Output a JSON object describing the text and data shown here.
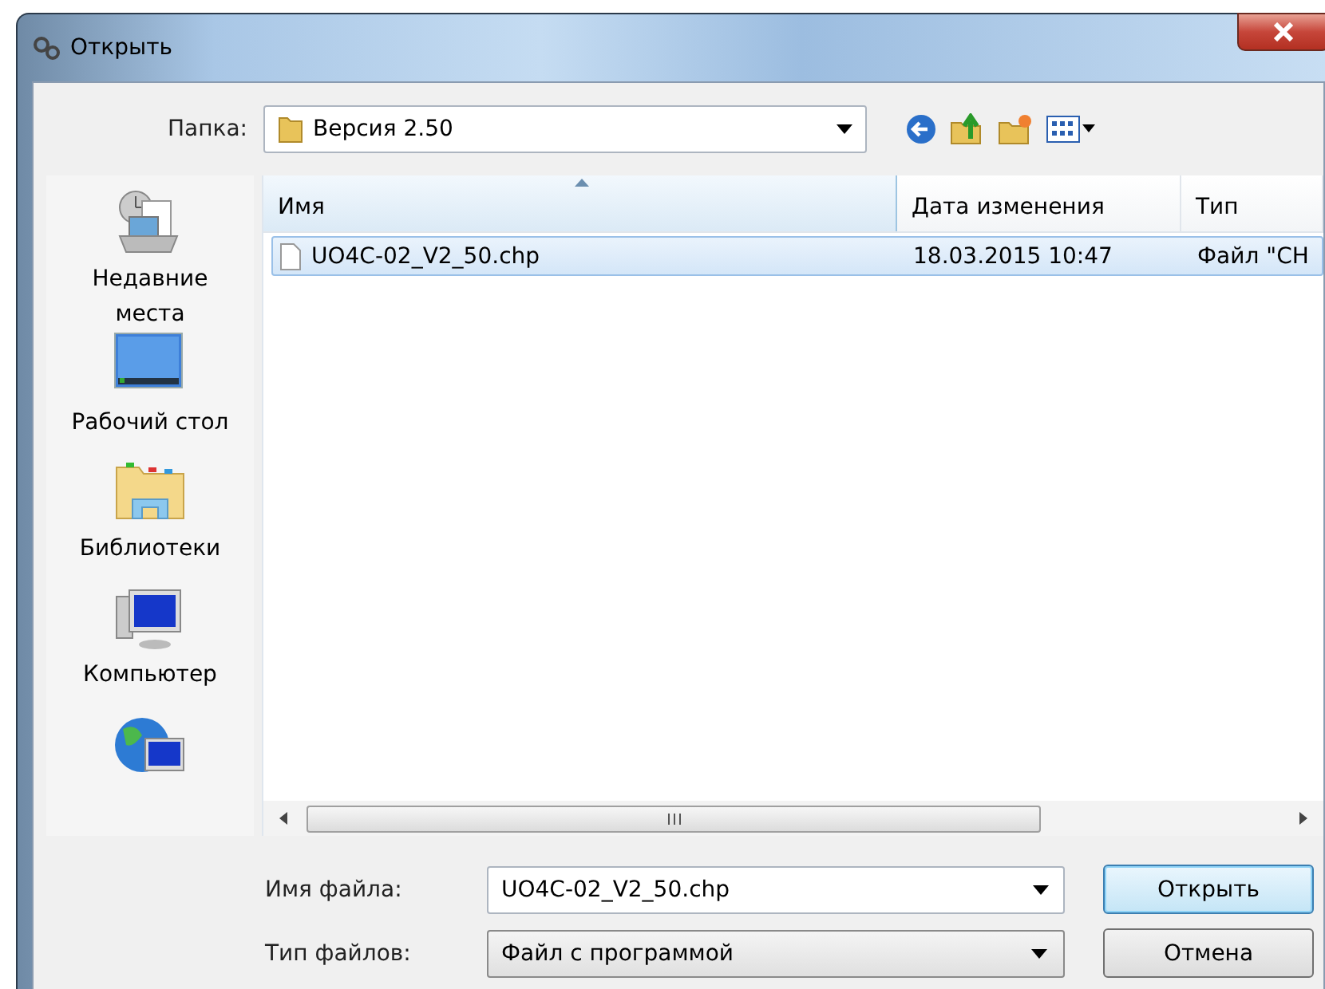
{
  "window": {
    "title": "Открыть"
  },
  "folder": {
    "label": "Папка:",
    "value": "Версия 2.50"
  },
  "sidebar": {
    "items": [
      {
        "kind": "recent",
        "label": "Недавние места"
      },
      {
        "kind": "desktop",
        "label": "Рабочий стол"
      },
      {
        "kind": "libraries",
        "label": "Библиотеки"
      },
      {
        "kind": "computer",
        "label": "Компьютер"
      },
      {
        "kind": "network"
      }
    ]
  },
  "table": {
    "columns": [
      {
        "label": "Имя",
        "sorted": true
      },
      {
        "label": "Дата изменения",
        "sorted": false
      },
      {
        "label": "Тип",
        "sorted": false
      }
    ],
    "rows": [
      {
        "cells": [
          "UO4C-02_V2_50.chp",
          "18.03.2015 10:47",
          "Файл \"CH"
        ],
        "selected": true
      }
    ]
  },
  "file_name": {
    "label": "Имя файла:",
    "value": "UO4C-02_V2_50.chp"
  },
  "file_type": {
    "label": "Тип файлов:",
    "value": "Файл с программой"
  },
  "buttons": [
    {
      "label": "Открыть",
      "default": true
    },
    {
      "label": "Отмена",
      "default": false
    }
  ]
}
